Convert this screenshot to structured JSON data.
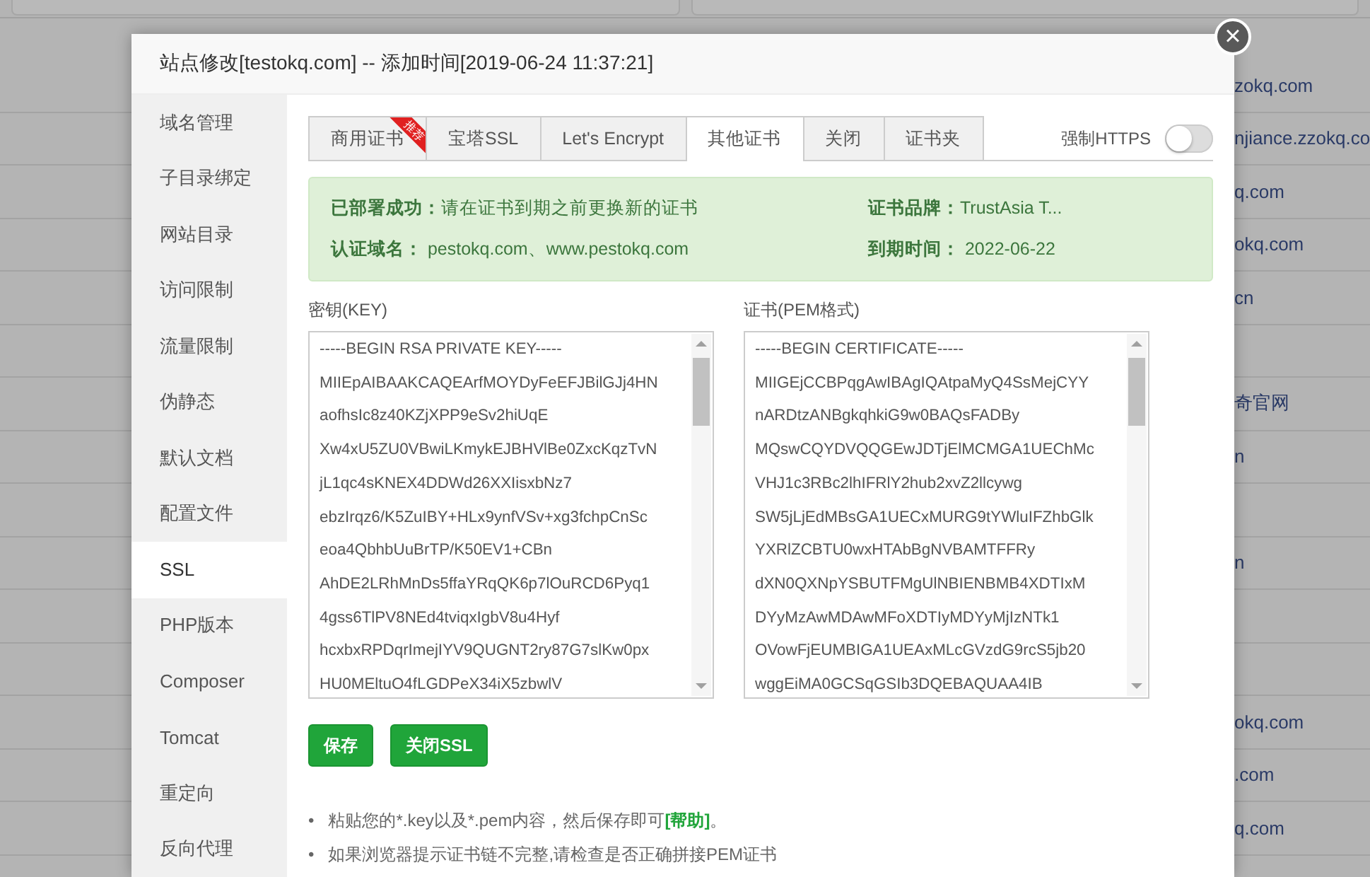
{
  "background_list": {
    "rows": [
      "zokq.com",
      "njiance.zzokq.co",
      "q.com",
      "okq.com",
      "cn",
      "",
      "奇官网",
      "n",
      "",
      "n",
      "",
      "",
      "okq.com",
      ".com",
      "q.com"
    ]
  },
  "modal": {
    "title": "站点修改[testokq.com] -- 添加时间[2019-06-24 11:37:21]",
    "close": "×",
    "sidebar": {
      "items": [
        {
          "label": "域名管理",
          "selected": false
        },
        {
          "label": "子目录绑定",
          "selected": false
        },
        {
          "label": "网站目录",
          "selected": false
        },
        {
          "label": "访问限制",
          "selected": false
        },
        {
          "label": "流量限制",
          "selected": false
        },
        {
          "label": "伪静态",
          "selected": false
        },
        {
          "label": "默认文档",
          "selected": false
        },
        {
          "label": "配置文件",
          "selected": false
        },
        {
          "label": "SSL",
          "selected": true
        },
        {
          "label": "PHP版本",
          "selected": false
        },
        {
          "label": "Composer",
          "selected": false
        },
        {
          "label": "Tomcat",
          "selected": false
        },
        {
          "label": "重定向",
          "selected": false
        },
        {
          "label": "反向代理",
          "selected": false
        }
      ]
    },
    "tabs": [
      {
        "label": "商用证书",
        "selected": false,
        "badge": "推荐"
      },
      {
        "label": "宝塔SSL",
        "selected": false
      },
      {
        "label": "Let's Encrypt",
        "selected": false
      },
      {
        "label": "其他证书",
        "selected": true
      },
      {
        "label": "关闭",
        "selected": false
      },
      {
        "label": "证书夹",
        "selected": false
      }
    ],
    "force_https": {
      "label": "强制HTTPS",
      "on": false
    },
    "status": {
      "deployed_label": "已部署成功：",
      "deployed_text": "请在证书到期之前更换新的证书",
      "domains_label": "认证域名：",
      "domains": "pestokq.com、www.pestokq.com",
      "brand_label": "证书品牌：",
      "brand": "TrustAsia T...",
      "expiry_label": "到期时间：",
      "expiry": "2022-06-22"
    },
    "key": {
      "label": "密钥(KEY)",
      "lines": [
        "-----BEGIN RSA PRIVATE KEY-----",
        "MIIEpAIBAAKCAQEArfMOYDyFeEFJBilGJj4HN",
        "aofhsIc8z40KZjXPP9eSv2hiUqE",
        "Xw4xU5ZU0VBwiLKmykEJBHVlBe0ZxcKqzTvN",
        "jL1qc4sKNEX4DDWd26XXIisxbNz7",
        "ebzIrqz6/K5ZuIBY+HLx9ynfVSv+xg3fchpCnSc",
        "eoa4QbhbUuBrTP/K50EV1+CBn",
        "AhDE2LRhMnDs5ffaYRqQK6p7lOuRCD6Pyq1",
        "4gss6TlPV8NEd4tviqxIgbV8u4Hyf",
        "hcxbxRPDqrImejIYV9QUGNT2ry87G7slKw0px",
        "HU0MEltuO4fLGDPeX34iX5zbwlV"
      ]
    },
    "cert": {
      "label": "证书(PEM格式)",
      "lines": [
        "-----BEGIN CERTIFICATE-----",
        "MIIGEjCCBPqgAwIBAgIQAtpaMyQ4SsMejCYY",
        "nARDtzANBgkqhkiG9w0BAQsFADBy",
        "MQswCQYDVQQGEwJDTjElMCMGA1UEChMc",
        "VHJ1c3RBc2lhIFRlY2hub2xvZ2llcywg",
        "SW5jLjEdMBsGA1UECxMURG9tYWluIFZhbGlk",
        "YXRlZCBTU0wxHTAbBgNVBAMTFFRy",
        "dXN0QXNpYSBUTFMgUlNBIENBMB4XDTIxM",
        "DYyMzAwMDAwMFoXDTIyMDYyMjIzNTk1",
        "OVowFjEUMBIGA1UEAxMLcGVzdG9rcS5jb20",
        "wggEiMA0GCSqGSIb3DQEBAQUAA4IB"
      ]
    },
    "buttons": [
      {
        "label": "保存"
      },
      {
        "label": "关闭SSL"
      }
    ],
    "tips": [
      {
        "bullet": "•",
        "text": "粘贴您的*.key以及*.pem内容，然后保存即可",
        "link": "[帮助]",
        "tail": "。"
      },
      {
        "bullet": "•",
        "text": "如果浏览器提示证书链不完整,请检查是否正确拼接PEM证书"
      }
    ]
  }
}
